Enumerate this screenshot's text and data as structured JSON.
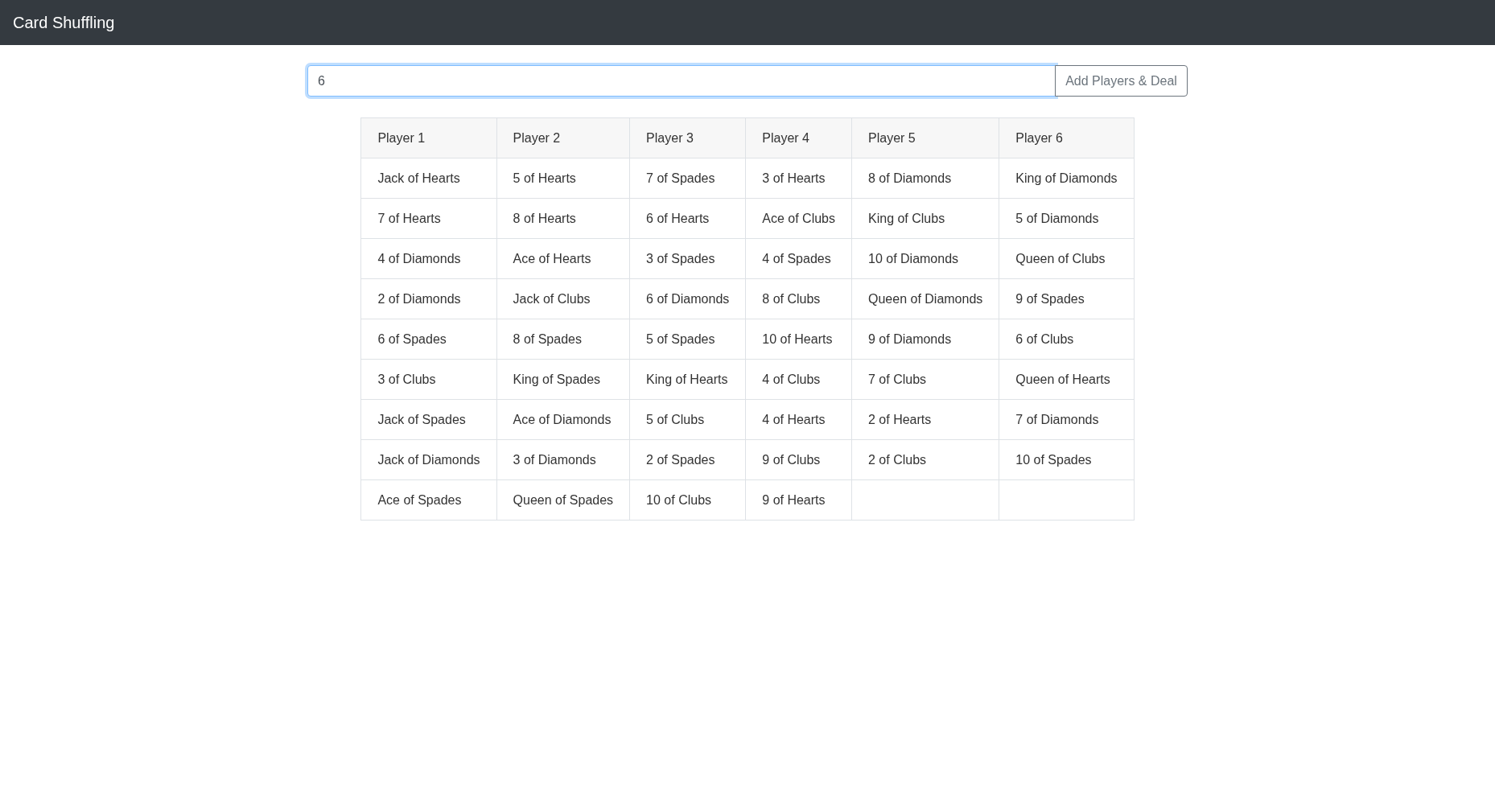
{
  "navbar": {
    "title": "Card Shuffling"
  },
  "form": {
    "input": {
      "value": "6",
      "focused": true
    },
    "button": "Add Players & Deal"
  },
  "players": [
    {
      "name": "Player 1",
      "cards": [
        "Jack of Hearts",
        "7 of Hearts",
        "4 of Diamonds",
        "2 of Diamonds",
        "6 of Spades",
        "3 of Clubs",
        "Jack of Spades",
        "Jack of Diamonds",
        "Ace of Spades"
      ]
    },
    {
      "name": "Player 2",
      "cards": [
        "5 of Hearts",
        "8 of Hearts",
        "Ace of Hearts",
        "Jack of Clubs",
        "8 of Spades",
        "King of Spades",
        "Ace of Diamonds",
        "3 of Diamonds",
        "Queen of Spades"
      ]
    },
    {
      "name": "Player 3",
      "cards": [
        "7 of Spades",
        "6 of Hearts",
        "3 of Spades",
        "6 of Diamonds",
        "5 of Spades",
        "King of Hearts",
        "5 of Clubs",
        "2 of Spades",
        "10 of Clubs"
      ]
    },
    {
      "name": "Player 4",
      "cards": [
        "3 of Hearts",
        "Ace of Clubs",
        "4 of Spades",
        "8 of Clubs",
        "10 of Hearts",
        "4 of Clubs",
        "4 of Hearts",
        "9 of Clubs",
        "9 of Hearts"
      ]
    },
    {
      "name": "Player 5",
      "cards": [
        "8 of Diamonds",
        "King of Clubs",
        "10 of Diamonds",
        "Queen of Diamonds",
        "9 of Diamonds",
        "7 of Clubs",
        "2 of Hearts",
        "2 of Clubs"
      ]
    },
    {
      "name": "Player 6",
      "cards": [
        "King of Diamonds",
        "5 of Diamonds",
        "Queen of Clubs",
        "9 of Spades",
        "6 of Clubs",
        "Queen of Hearts",
        "7 of Diamonds",
        "10 of Spades"
      ]
    }
  ]
}
